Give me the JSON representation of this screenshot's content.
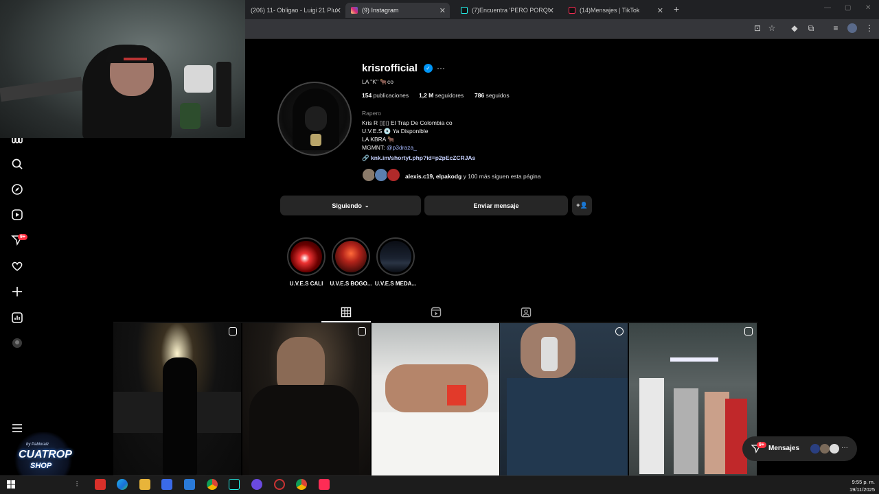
{
  "browser": {
    "tabs": [
      {
        "title": "(206) 11- Obligao - Luigi 21 Plu",
        "active": false
      },
      {
        "title": "(9) Instagram",
        "active": true
      },
      {
        "title": "(7)Encuentra 'PERO PORQUE T",
        "active": false
      },
      {
        "title": "(14)Mensajes | TikTok",
        "active": false
      }
    ],
    "new_tab": "+",
    "close_glyph": "✕"
  },
  "profile": {
    "username": "krisrofficial",
    "verified_glyph": "✓",
    "more": "···",
    "subname": "LA \"K\" 🐂co",
    "stats": {
      "posts_count": "154",
      "posts_label": "publicaciones",
      "followers_count": "1,2 M",
      "followers_label": "seguidores",
      "following_count": "786",
      "following_label": "seguidos"
    },
    "category": "Rapero",
    "bio_lines": [
      "Kris R ▯▯▯ El Trap De Colombia co",
      "U.V.E.S 💿 Ya Disponible",
      "LA KBRA 🐂",
      "MGMNT: "
    ],
    "bio_mention": "@p3draza_",
    "link": "knk.im/shortyt.php?id=p2pEcZCRJAs",
    "followed_by_names": "alexis.c19, elpakodg",
    "followed_by_rest": " y 100 más siguen esta página"
  },
  "buttons": {
    "following": "Siguiendo",
    "message": "Enviar mensaje"
  },
  "highlights": [
    {
      "label": "U.V.E.S CALI"
    },
    {
      "label": "U.V.E.S BOGO..."
    },
    {
      "label": "U.V.E.S MEDA..."
    }
  ],
  "nav_badges": {
    "notifications": "9+",
    "messages": "9+"
  },
  "messages_bar": {
    "label": "Mensajes",
    "more": "···"
  },
  "shop": {
    "top": "by Pabloraiz",
    "name1": "CUATROP",
    "name2": "SHOP"
  },
  "clock": {
    "time": "9:55 p. m.",
    "date": "19/11/2025"
  }
}
